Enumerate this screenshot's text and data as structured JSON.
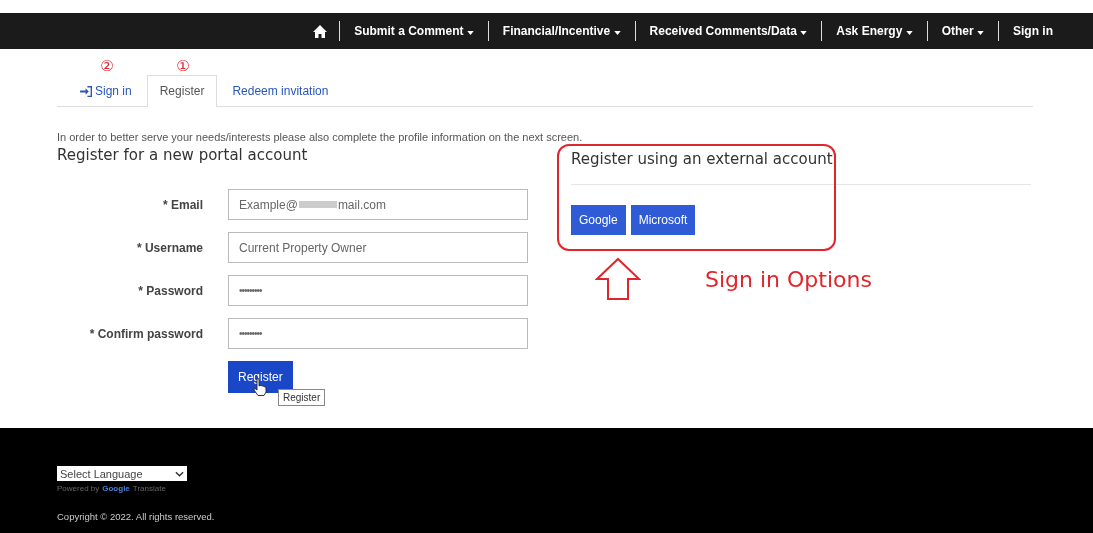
{
  "nav": {
    "items": [
      {
        "kind": "home"
      },
      {
        "kind": "menu",
        "label": "Submit a Comment"
      },
      {
        "kind": "menu",
        "label": "Financial/Incentive"
      },
      {
        "kind": "menu",
        "label": "Received Comments/Data"
      },
      {
        "kind": "menu",
        "label": "Ask Energy"
      },
      {
        "kind": "menu",
        "label": "Other"
      },
      {
        "kind": "link",
        "label": "Sign in"
      }
    ]
  },
  "tabs": [
    {
      "label": "Sign in",
      "icon": true,
      "selected": false,
      "annotation": "②"
    },
    {
      "label": "Register",
      "icon": false,
      "selected": true,
      "annotation": "①"
    },
    {
      "label": "Redeem invitation",
      "icon": false,
      "selected": false
    }
  ],
  "intro": "In order to better serve your needs/interests please also complete the profile information on the next screen.",
  "register_heading": "Register for a new portal account",
  "fields": [
    {
      "label": "* Email",
      "kind": "text",
      "value_start": "Example@",
      "redacted": true,
      "value_end": "mail.com"
    },
    {
      "label": "* Username",
      "kind": "text",
      "value_start": "Current Property Owner",
      "redacted": false
    },
    {
      "label": "* Password",
      "kind": "password",
      "value_start": "•••••••••",
      "redacted": false
    },
    {
      "label": "* Confirm password",
      "kind": "password",
      "value_start": "•••••••••",
      "redacted": false
    }
  ],
  "register_button": {
    "label": "Register",
    "tooltip": "Register"
  },
  "external": {
    "heading": "Register using an external account",
    "buttons": [
      "Google",
      "Microsoft"
    ],
    "annotation": "Sign in Options"
  },
  "footer": {
    "language_select": "Select Language",
    "powered_by": "Powered by",
    "google": "Google",
    "translate": "Translate",
    "copyright": "Copyright © 2022. All rights reserved."
  }
}
